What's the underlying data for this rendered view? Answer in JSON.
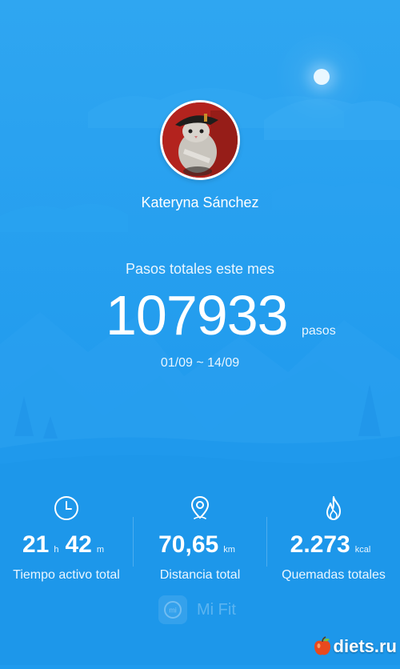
{
  "profile": {
    "name": "Kateryna Sánchez"
  },
  "summary": {
    "title": "Pasos totales este mes",
    "steps": "107933",
    "steps_unit": "pasos",
    "date_range": "01/09 ~ 14/09"
  },
  "stats": [
    {
      "icon": "clock-icon",
      "parts": [
        {
          "value": "21",
          "unit": "h"
        },
        {
          "value": "42",
          "unit": "m"
        }
      ],
      "label": "Tiempo activo total"
    },
    {
      "icon": "location-pin-icon",
      "parts": [
        {
          "value": "70,65",
          "unit": "km"
        }
      ],
      "label": "Distancia total"
    },
    {
      "icon": "flame-icon",
      "parts": [
        {
          "value": "2.273",
          "unit": "kcal"
        }
      ],
      "label": "Quemadas totales"
    }
  ],
  "brand": {
    "logo_text": "mi",
    "name": "Mi Fit"
  },
  "watermark": {
    "text": "diets.ru"
  },
  "colors": {
    "background": "#1f9bee",
    "avatar_bg": "#b3231e",
    "text": "#ffffff"
  }
}
